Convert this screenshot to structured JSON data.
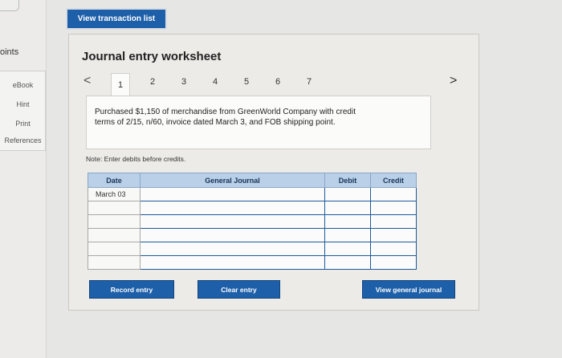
{
  "rail": {
    "points_label": "oints",
    "items": [
      "eBook",
      "Hint",
      "Print",
      "References"
    ]
  },
  "top_button": "View transaction list",
  "worksheet": {
    "title": "Journal entry worksheet",
    "nav_prev": "<",
    "nav_next": ">",
    "tabs": [
      "1",
      "2",
      "3",
      "4",
      "5",
      "6",
      "7"
    ],
    "active_tab": "1",
    "description_line1": "Purchased $1,150 of merchandise from GreenWorld Company with credit",
    "description_line2": "terms of 2/15, n/60, invoice dated March 3, and FOB shipping point.",
    "note": "Note: Enter debits before credits."
  },
  "table": {
    "headers": [
      "Date",
      "General Journal",
      "Debit",
      "Credit"
    ],
    "rows": [
      {
        "date": "March 03"
      },
      {
        "date": ""
      },
      {
        "date": ""
      },
      {
        "date": ""
      },
      {
        "date": ""
      },
      {
        "date": ""
      }
    ]
  },
  "buttons": {
    "record": "Record entry",
    "clear": "Clear entry",
    "view_journal": "View general journal"
  },
  "colors": {
    "button_blue": "#1d5fa8",
    "header_blue": "#b9d0e8",
    "input_border": "#1e5a99"
  }
}
